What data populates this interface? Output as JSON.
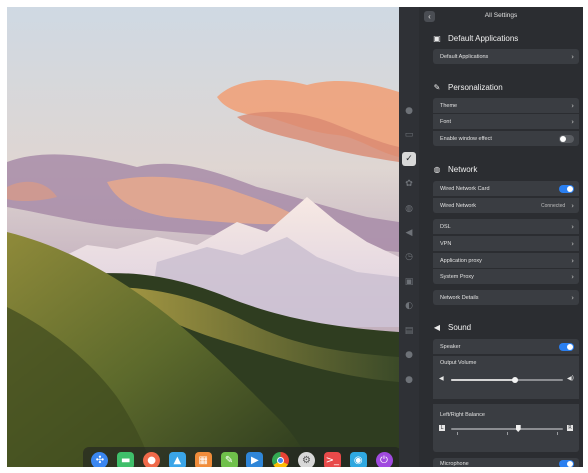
{
  "window": {
    "title": "All Settings",
    "back_icon": "chevron-left-icon"
  },
  "sections": {
    "default_apps": {
      "title": "Default Applications",
      "icon": "calendar-check-icon",
      "rows": [
        "Default Applications"
      ]
    },
    "personalization": {
      "title": "Personalization",
      "icon": "palette-icon",
      "rows": [
        {
          "label": "Theme"
        },
        {
          "label": "Font"
        },
        {
          "label": "Enable window effect",
          "toggle": false
        }
      ]
    },
    "network": {
      "title": "Network",
      "icon": "globe-icon",
      "rows": [
        {
          "label": "Wired Network Card",
          "toggle": true
        },
        {
          "label": "Wired Network",
          "value": "Connected"
        },
        {
          "label": "DSL"
        },
        {
          "label": "VPN"
        },
        {
          "label": "Application proxy"
        },
        {
          "label": "System Proxy"
        },
        {
          "label": "Network Details"
        }
      ]
    },
    "sound": {
      "title": "Sound",
      "icon": "speaker-icon",
      "speaker": {
        "label": "Speaker",
        "toggle": true
      },
      "output_volume": {
        "label": "Output Volume",
        "level": 0.57
      },
      "balance": {
        "label": "Left/Right Balance",
        "level": 0.6,
        "left": "L",
        "right": "R"
      },
      "microphone": {
        "label": "Microphone",
        "toggle": true
      }
    }
  },
  "dock_apps": [
    "launcher-icon",
    "file-manager-icon",
    "music-icon",
    "app-store-icon",
    "calendar-icon",
    "notes-icon",
    "video-icon",
    "chrome-icon",
    "settings-icon",
    "terminal-icon",
    "screenshot-icon",
    "power-icon"
  ],
  "colors": {
    "accent": "#2a7ff0",
    "panel_bg": "#2b2d31",
    "row_bg": "#3a3d42"
  }
}
